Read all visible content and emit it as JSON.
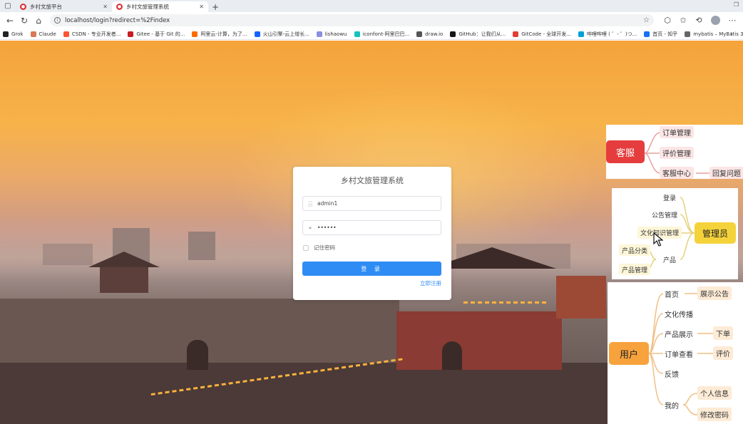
{
  "browser": {
    "tabs": [
      {
        "label": "乡村文旅平台",
        "active": false
      },
      {
        "label": "乡村文旅管理系统",
        "active": true
      }
    ],
    "url": "localhost/login?redirect=%2Findex",
    "bookmarks": [
      {
        "label": "Grok",
        "color": "#222222"
      },
      {
        "label": "Claude",
        "color": "#d97757"
      },
      {
        "label": "CSDN - 专业开发者...",
        "color": "#fc5531"
      },
      {
        "label": "Gitee - 基于 Git 的...",
        "color": "#c71d23"
      },
      {
        "label": "阿里云-计算，为了...",
        "color": "#ff6a00"
      },
      {
        "label": "火山引擎-云上增长...",
        "color": "#1664ff"
      },
      {
        "label": "lishaowu",
        "color": "#8a8fe0"
      },
      {
        "label": "iconfont-阿里巴巴...",
        "color": "#13c2c2"
      },
      {
        "label": "draw.io",
        "color": "#555555"
      },
      {
        "label": "GitHub：让我们从...",
        "color": "#181717"
      },
      {
        "label": "GitCode - 全球开发...",
        "color": "#e33e33"
      },
      {
        "label": "哔哩哔哩 ( ゜- ゜)つ...",
        "color": "#00a1d6"
      },
      {
        "label": "首页 - 知乎",
        "color": "#1772f6"
      },
      {
        "label": "mybatis – MyBatis 3...",
        "color": "#666666"
      }
    ]
  },
  "login": {
    "title": "乡村文旅管理系统",
    "username": "admin1",
    "password": "••••••",
    "remember_label": "记住密码",
    "submit_label": "登 录",
    "register_label": "立即注册"
  },
  "mindmaps": {
    "customer_service": {
      "root": "客服",
      "children": [
        "订单管理",
        "评价管理",
        "客服中心"
      ],
      "grandchild": "回复问题"
    },
    "admin": {
      "root": "管理员",
      "children": [
        "登录",
        "公告管理",
        "文化知识管理",
        "产品"
      ],
      "product_children": [
        "产品分类",
        "产品管理"
      ]
    },
    "user": {
      "root": "用户",
      "children": [
        "首页",
        "文化传播",
        "产品展示",
        "订单查看",
        "反馈",
        "我的"
      ],
      "home_child": "展示公告",
      "product_child": "下单",
      "order_child": "评价",
      "mine_children": [
        "个人信息",
        "修改密码"
      ]
    }
  },
  "colors": {
    "primary": "#2f8cf5",
    "cs_root": "#e53d3d",
    "admin_root": "#f4d23a",
    "user_root": "#f7a23c"
  }
}
